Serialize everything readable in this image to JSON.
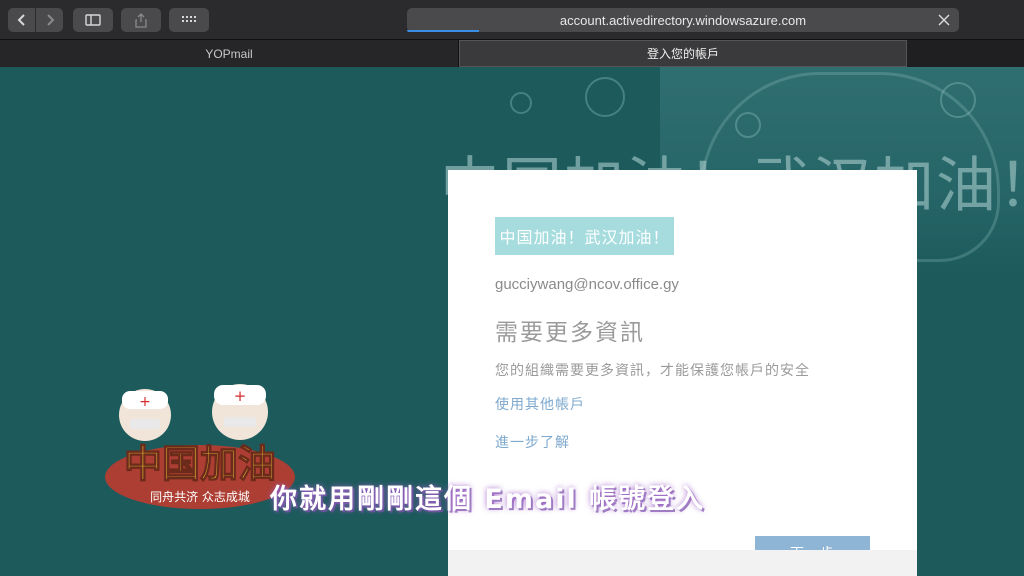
{
  "browser": {
    "url": "account.activedirectory.windowsazure.com",
    "tabs": [
      {
        "label": "YOPmail"
      },
      {
        "label": "登入您的帳戶"
      }
    ]
  },
  "background": {
    "banner_text": "中国加油！武汉加油！"
  },
  "signin": {
    "org_banner": "中国加油！武汉加油！",
    "email": "gucciywang@ncov.office.gy",
    "heading": "需要更多資訊",
    "description": "您的組織需要更多資訊，才能保護您帳戶的安全",
    "use_other_account": "使用其他帳戶",
    "learn_more": "進一步了解",
    "next_button": "下一步"
  },
  "mascot": {
    "logo_text": "中国加油",
    "slogan": "同舟共济 众志成城"
  },
  "caption": {
    "text": "你就用剛剛這個 Email 帳號登入"
  },
  "colors": {
    "page_bg": "#1c5a5c",
    "org_banner_bg": "#a7dcdf",
    "link": "#7ea9cf",
    "button": "#8fb5d6",
    "url_progress": "#3a8ee6"
  }
}
